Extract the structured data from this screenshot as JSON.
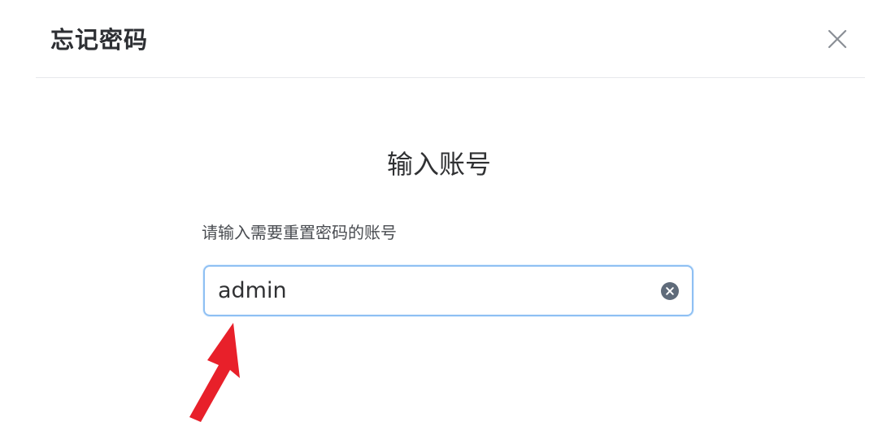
{
  "dialog": {
    "title": "忘记密码",
    "close_icon": "close-icon"
  },
  "step": {
    "title": "输入账号"
  },
  "account_field": {
    "label": "请输入需要重置密码的账号",
    "value": "admin",
    "clear_icon": "clear-circle-icon"
  },
  "annotation": {
    "arrow_icon": "red-arrow-icon",
    "color": "#e8202a"
  },
  "colors": {
    "input_focus_border": "#8fc0f3",
    "title_text": "#2d2f33",
    "clear_icon_fill": "#5f6b7a"
  }
}
